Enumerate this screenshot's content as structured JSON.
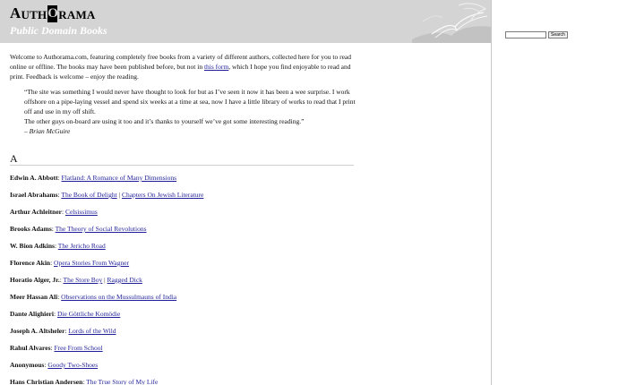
{
  "site": {
    "logo_first": "A",
    "logo_part1": "UTH",
    "logo_boxed": "O",
    "logo_part2": "RAMA",
    "tagline": "Public Domain Books"
  },
  "search": {
    "input_value": "",
    "button_label": "Search"
  },
  "intro": {
    "text_before_link": "Welcome to Authorama.com, featuring completely free books from a variety of different authors, collected here for you to read online or offline. The books may have been published before, but not in ",
    "link_text": "this form",
    "text_after_link": ", which I hope you find enjoyable to read and print. Feedback is welcome – enjoy the reading."
  },
  "quote": {
    "line1": "“The site was something I would never have thought to look for but as I’ve seen it now it has been a wee surprise. I work offshore on a pipe-laying vessel and spend six weeks at a time at sea, now I have a little library of works to read that I print off and use in my off shift.",
    "line2": "The other guys on-board are using it too and it’s thanks to yourself we’ve got some interesting reading.”",
    "attribution": "– Brian McGuire"
  },
  "section_letter": "A",
  "authors": [
    {
      "name": "Edwin A. Abbott",
      "books": [
        "Flatland: A Romance of Many Dimensions"
      ]
    },
    {
      "name": "Israel Abrahams",
      "books": [
        "The Book of Delight",
        "Chapters On Jewish Literature"
      ]
    },
    {
      "name": "Arthur Achleitner",
      "books": [
        "Celsissimus"
      ]
    },
    {
      "name": "Brooks Adams",
      "books": [
        "The Theory of Social Revolutions"
      ]
    },
    {
      "name": "W. Bion Adkins",
      "books": [
        "The Jericho Road"
      ]
    },
    {
      "name": "Florence Akin",
      "books": [
        "Opera Stories From Wagner"
      ]
    },
    {
      "name": "Horatio Alger, Jr.",
      "books": [
        "The Store Boy",
        "Ragged Dick"
      ]
    },
    {
      "name": "Meer Hassan Ali",
      "books": [
        "Observations on the Mussulmauns of India"
      ]
    },
    {
      "name": "Dante Alighieri",
      "books": [
        "Die Göttliche Komödie"
      ]
    },
    {
      "name": "Joseph A. Altsheler",
      "books": [
        "Lords of the Wild"
      ]
    },
    {
      "name": "Rahul Alvares",
      "books": [
        "Free From School"
      ]
    },
    {
      "name": "Anonymous",
      "books": [
        "Goody Two-Shoes"
      ]
    },
    {
      "name": "Hans Christian Andersen",
      "books": [
        "The True Story of My Life"
      ]
    }
  ],
  "colors": {
    "header_bg": "#d4d4d4",
    "link": "#1f1f9a",
    "tagline": "#ffffff"
  }
}
